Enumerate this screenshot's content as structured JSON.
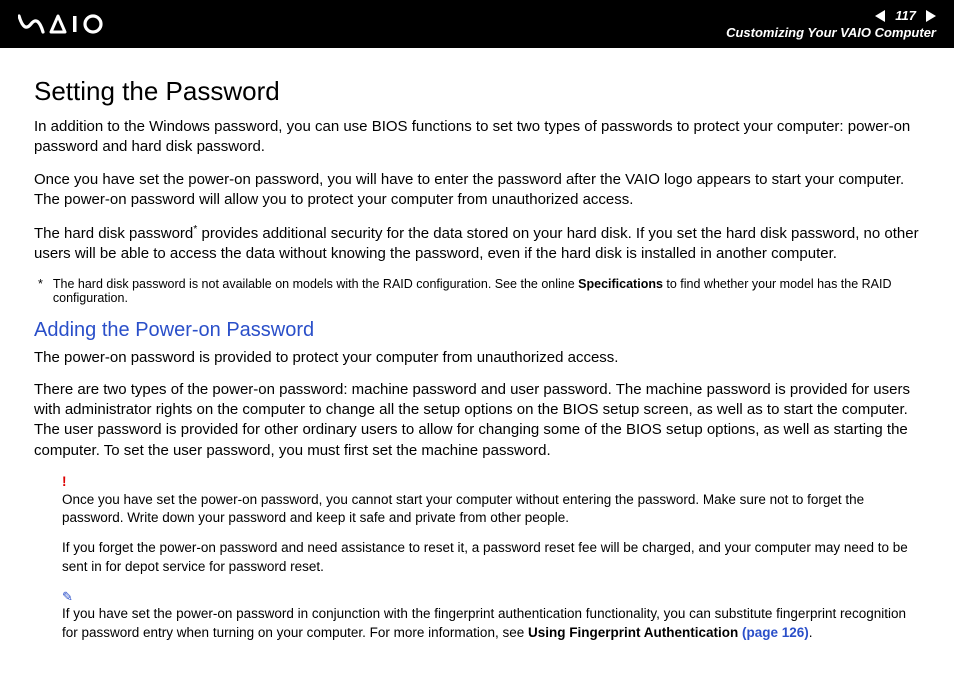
{
  "header": {
    "page_number": "117",
    "breadcrumb": "Customizing Your VAIO Computer"
  },
  "main": {
    "title": "Setting the Password",
    "p1": "In addition to the Windows password, you can use BIOS functions to set two types of passwords to protect your computer: power-on password and hard disk password.",
    "p2": "Once you have set the power-on password, you will have to enter the password after the VAIO logo appears to start your computer. The power-on password will allow you to protect your computer from unauthorized access.",
    "p3_a": "The hard disk password",
    "p3_b": " provides additional security for the data stored on your hard disk. If you set the hard disk password, no other users will be able to access the data without knowing the password, even if the hard disk is installed in another computer.",
    "footnote_mark": "*",
    "footnote_a": "The hard disk password is not available on models with the RAID configuration. See the online ",
    "footnote_bold": "Specifications",
    "footnote_b": " to find whether your model has the RAID configuration.",
    "subhead": "Adding the Power-on Password",
    "p4": "The power-on password is provided to protect your computer from unauthorized access.",
    "p5": "There are two types of the power-on password: machine password and user password. The machine password is provided for users with administrator rights on the computer to change all the setup options on the BIOS setup screen, as well as to start the computer. The user password is provided for other ordinary users to allow for changing some of the BIOS setup options, as well as starting the computer. To set the user password, you must first set the machine password.",
    "warn_icon": "!",
    "warn1": "Once you have set the power-on password, you cannot start your computer without entering the password. Make sure not to forget the password. Write down your password and keep it safe and private from other people.",
    "warn2": "If you forget the power-on password and need assistance to reset it, a password reset fee will be charged, and your computer may need to be sent in for depot service for password reset.",
    "tip_icon": "✎",
    "tip_a": "If you have set the power-on password in conjunction with the fingerprint authentication functionality, you can substitute fingerprint recognition for password entry when turning on your computer. For more information, see ",
    "tip_bold": "Using Fingerprint Authentication ",
    "tip_link": "(page 126)",
    "tip_end": "."
  }
}
